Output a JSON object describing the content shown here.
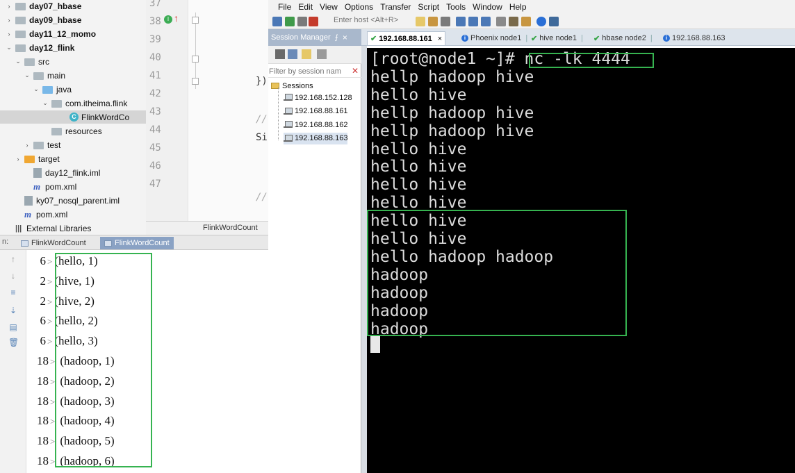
{
  "project_tree": {
    "items": [
      {
        "label": "day07_hbase",
        "bold": true,
        "expanded": false
      },
      {
        "label": "day09_hbase",
        "bold": true,
        "expanded": false
      },
      {
        "label": "day11_12_momo",
        "bold": true,
        "expanded": false
      },
      {
        "label": "day12_flink",
        "bold": true,
        "expanded": true
      },
      {
        "label": "src"
      },
      {
        "label": "main"
      },
      {
        "label": "java"
      },
      {
        "label": "com.itheima.flink"
      },
      {
        "label": "FlinkWordCo"
      },
      {
        "label": "resources"
      },
      {
        "label": "test"
      },
      {
        "label": "target"
      },
      {
        "label": "day12_flink.iml"
      },
      {
        "label": "pom.xml"
      },
      {
        "label": "ky07_nosql_parent.iml"
      },
      {
        "label": "pom.xml"
      },
      {
        "label": "External Libraries"
      }
    ]
  },
  "editor": {
    "line_numbers": [
      "37",
      "38",
      "39",
      "40",
      "41",
      "42",
      "43",
      "44",
      "45",
      "46",
      "47"
    ],
    "code_close": "})",
    "code_si": "Si",
    "comment_mark": "//",
    "bottom_label": "FlinkWordCount"
  },
  "run_window": {
    "prefix": "n:",
    "tabs": [
      {
        "label": "FlinkWordCount",
        "active": false
      },
      {
        "label": "FlinkWordCount",
        "active": true
      }
    ],
    "output": [
      {
        "p": "6",
        "t": "(hello, 1)"
      },
      {
        "p": "2",
        "t": "(hive, 1)"
      },
      {
        "p": "2",
        "t": "(hive, 2)"
      },
      {
        "p": "6",
        "t": "(hello, 2)"
      },
      {
        "p": "6",
        "t": "(hello, 3)"
      },
      {
        "p": "18",
        "t": "(hadoop, 1)"
      },
      {
        "p": "18",
        "t": "(hadoop, 2)"
      },
      {
        "p": "18",
        "t": "(hadoop, 3)"
      },
      {
        "p": "18",
        "t": "(hadoop, 4)"
      },
      {
        "p": "18",
        "t": "(hadoop, 5)"
      },
      {
        "p": "18",
        "t": "(hadoop, 6)"
      }
    ],
    "gt": ">"
  },
  "crt": {
    "menu": [
      "File",
      "Edit",
      "View",
      "Options",
      "Transfer",
      "Script",
      "Tools",
      "Window",
      "Help"
    ],
    "host_placeholder": "Enter host <Alt+R>",
    "session_manager": {
      "title": "Session Manager",
      "pin": "⨍",
      "close": "×",
      "filter_placeholder": "Filter by session nam",
      "root": "Sessions",
      "sessions": [
        "192.168.152.128",
        "192.168.88.161",
        "192.168.88.162",
        "192.168.88.163"
      ]
    },
    "tabs": [
      {
        "label": "192.168.88.161",
        "icon": "ok",
        "active": true
      },
      {
        "label": "Phoenix node1",
        "icon": "info",
        "active": false
      },
      {
        "label": "hive node1",
        "icon": "ok",
        "active": false
      },
      {
        "label": "hbase node2",
        "icon": "ok",
        "active": false
      },
      {
        "label": "192.168.88.163",
        "icon": "info",
        "active": false
      }
    ],
    "terminal_lines": [
      "[root@node1 ~]# nc -lk 4444",
      "hellp hadoop hive",
      "hello hive",
      "hellp hadoop hive",
      "hellp hadoop hive",
      "hello hive",
      "hello hive",
      "hello hive",
      "hello hive",
      "hello hive",
      "hello hive",
      "hello hadoop hadoop",
      "hadoop",
      "hadoop",
      "hadoop",
      "hadoop"
    ]
  }
}
